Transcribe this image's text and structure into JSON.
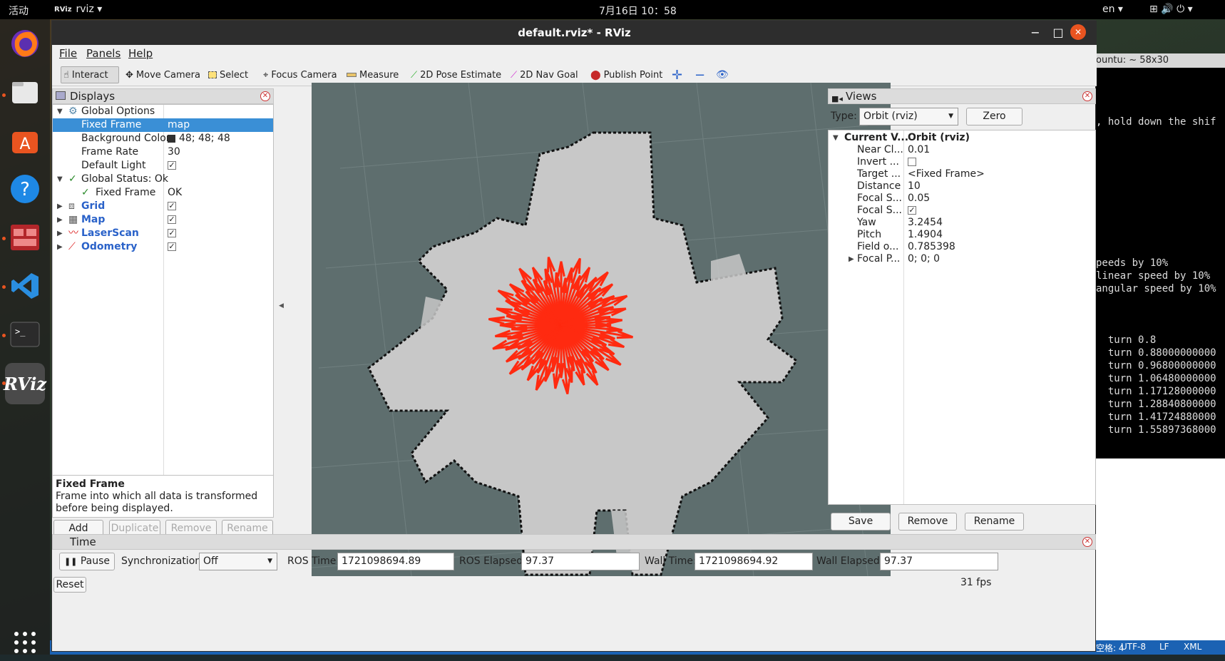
{
  "topbar": {
    "activities": "活动",
    "app": "rviz ▾",
    "clock": "7月16日  10：58",
    "lang": "en ▾",
    "indicators": "⊞  🔊  ⏻ ▾"
  },
  "dock": {
    "apps": [
      "firefox-icon",
      "files-icon",
      "software-icon",
      "help-icon",
      "app-icon",
      "vscode-icon",
      "terminal-icon",
      "rviz-icon",
      "grid-icon"
    ]
  },
  "terminal": {
    "title": "ountu: ~ 58x30",
    "lines": [
      ", hold down the shif",
      "",
      "",
      "",
      "",
      "",
      "",
      "",
      "",
      "",
      "",
      "peeds by 10%",
      "linear speed by 10%",
      "angular speed by 10%",
      "",
      "",
      "",
      "  turn 0.8",
      "  turn 0.88000000000",
      "  turn 0.96800000000",
      "  turn 1.06480000000",
      "  turn 1.17128000000",
      "  turn 1.28840800000",
      "  turn 1.41724880000",
      "  turn 1.55897368000"
    ]
  },
  "statusbar": {
    "items": [
      "空格: 4",
      "UTF-8",
      "LF",
      "XML"
    ]
  },
  "window": {
    "title": "default.rviz* - RViz",
    "minimize": "−",
    "maximize": "□",
    "close": "✕"
  },
  "menu": {
    "file": "File",
    "panels": "Panels",
    "help": "Help"
  },
  "toolbar": {
    "interact": "Interact",
    "move_camera": "Move Camera",
    "select": "Select",
    "focus_camera": "Focus Camera",
    "measure": "Measure",
    "pose_estimate": "2D Pose Estimate",
    "nav_goal": "2D Nav Goal",
    "publish_point": "Publish Point"
  },
  "displays": {
    "title": "Displays",
    "rows": [
      {
        "label": "Global Options",
        "value": ""
      },
      {
        "label": "Fixed Frame",
        "value": "map"
      },
      {
        "label": "Background Color",
        "value": "48; 48; 48"
      },
      {
        "label": "Frame Rate",
        "value": "30"
      },
      {
        "label": "Default Light",
        "value": "✓"
      },
      {
        "label": "Global Status: Ok",
        "value": ""
      },
      {
        "label": "Fixed Frame",
        "value": "OK"
      },
      {
        "label": "Grid",
        "value": "✓"
      },
      {
        "label": "Map",
        "value": "✓"
      },
      {
        "label": "LaserScan",
        "value": "✓"
      },
      {
        "label": "Odometry",
        "value": "✓"
      }
    ],
    "desc_title": "Fixed Frame",
    "desc_text": "Frame into which all data is transformed before being displayed.",
    "buttons": {
      "add": "Add",
      "duplicate": "Duplicate",
      "remove": "Remove",
      "rename": "Rename"
    }
  },
  "views": {
    "title": "Views",
    "type_label": "Type:",
    "type_value": "Orbit (rviz)",
    "zero": "Zero",
    "rows": [
      {
        "label": "Current V...",
        "value": "Orbit (rviz)"
      },
      {
        "label": "Near Cl...",
        "value": "0.01"
      },
      {
        "label": "Invert ...",
        "value": ""
      },
      {
        "label": "Target ...",
        "value": "<Fixed Frame>"
      },
      {
        "label": "Distance",
        "value": "10"
      },
      {
        "label": "Focal S...",
        "value": "0.05"
      },
      {
        "label": "Focal S...",
        "value": "✓"
      },
      {
        "label": "Yaw",
        "value": "3.2454"
      },
      {
        "label": "Pitch",
        "value": "1.4904"
      },
      {
        "label": "Field o...",
        "value": "0.785398"
      },
      {
        "label": "Focal P...",
        "value": "0; 0; 0"
      }
    ],
    "buttons": {
      "save": "Save",
      "remove": "Remove",
      "rename": "Rename"
    }
  },
  "time": {
    "title": "Time",
    "pause": "Pause",
    "sync_label": "Synchronization:",
    "sync_value": "Off",
    "ros_time_label": "ROS Time:",
    "ros_time": "1721098694.89",
    "ros_elapsed_label": "ROS Elapsed:",
    "ros_elapsed": "97.37",
    "wall_time_label": "Wall Time:",
    "wall_time": "1721098694.92",
    "wall_elapsed_label": "Wall Elapsed:",
    "wall_elapsed": "97.37",
    "reset": "Reset",
    "fps": "31 fps"
  },
  "colors": {
    "selection": "#3a8fd6",
    "laser": "#ff2a10",
    "viewport_bg": "#5e6e6e",
    "map_free": "#c8c8c8",
    "map_wall": "#000000"
  }
}
